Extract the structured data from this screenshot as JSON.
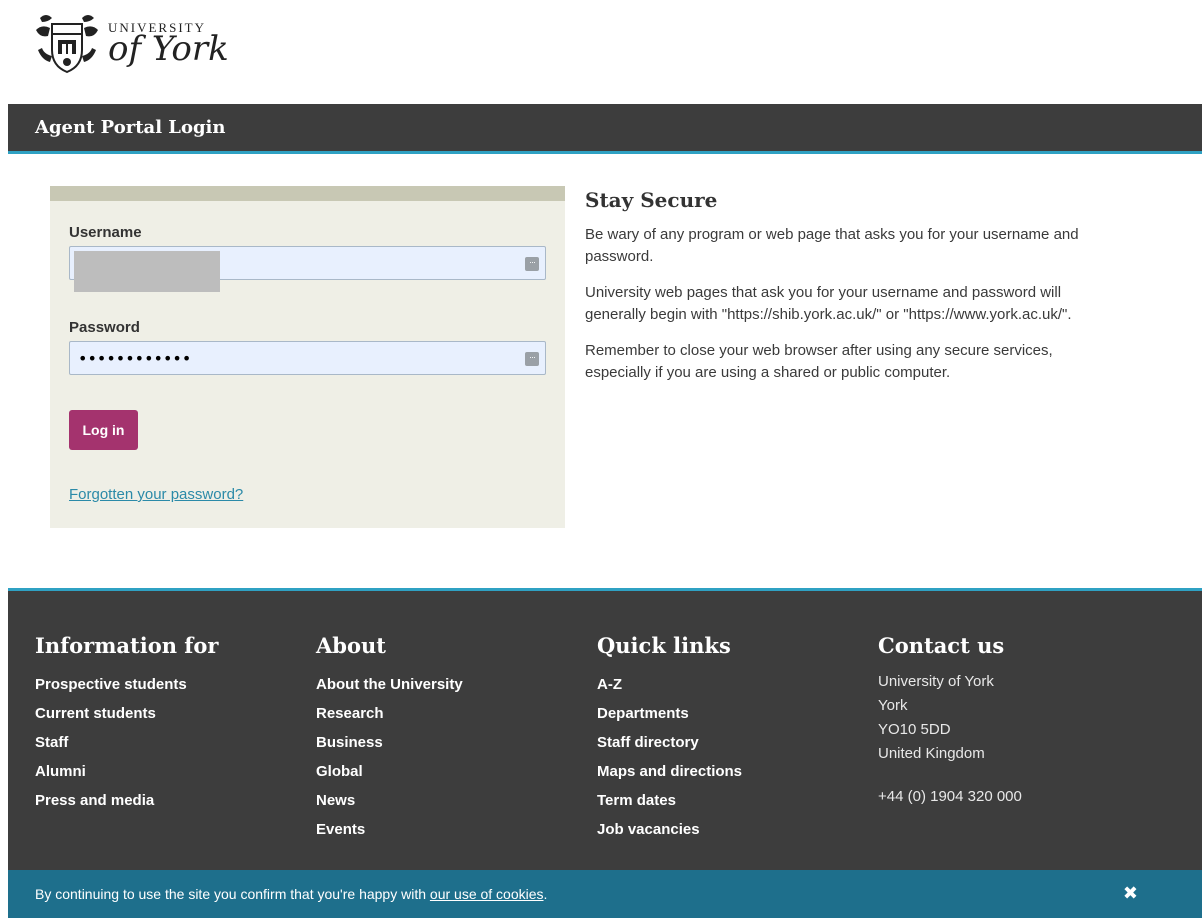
{
  "brand": {
    "line1": "UNIVERSITY",
    "line2": "of York"
  },
  "page_title": "Agent Portal Login",
  "login": {
    "username_label": "Username",
    "username_value": "",
    "password_label": "Password",
    "password_value": "••••••••••••",
    "login_button": "Log in",
    "forgot_link": "Forgotten your password?"
  },
  "secure": {
    "heading": "Stay Secure",
    "p1": "Be wary of any program or web page that asks you for your username and password.",
    "p2": "University web pages that ask you for your username and password will generally begin with \"https://shib.york.ac.uk/\" or \"https://www.york.ac.uk/\".",
    "p3": "Remember to close your web browser after using any secure services, especially if you are using a shared or public computer."
  },
  "footer": {
    "info": {
      "heading": "Information for",
      "items": [
        "Prospective students",
        "Current students",
        "Staff",
        "Alumni",
        "Press and media"
      ]
    },
    "about": {
      "heading": "About",
      "items": [
        "About the University",
        "Research",
        "Business",
        "Global",
        "News",
        "Events"
      ]
    },
    "quick": {
      "heading": "Quick links",
      "items": [
        "A-Z",
        "Departments",
        "Staff directory",
        "Maps and directions",
        "Term dates",
        "Job vacancies"
      ]
    },
    "contact": {
      "heading": "Contact us",
      "address": [
        "University of York",
        "York",
        "YO10 5DD",
        "United Kingdom"
      ],
      "phone": "+44 (0) 1904 320 000"
    }
  },
  "cookie": {
    "text": "By continuing to use the site you confirm that you're happy with ",
    "link": "our use of cookies",
    "suffix": ".",
    "close": "✖"
  }
}
